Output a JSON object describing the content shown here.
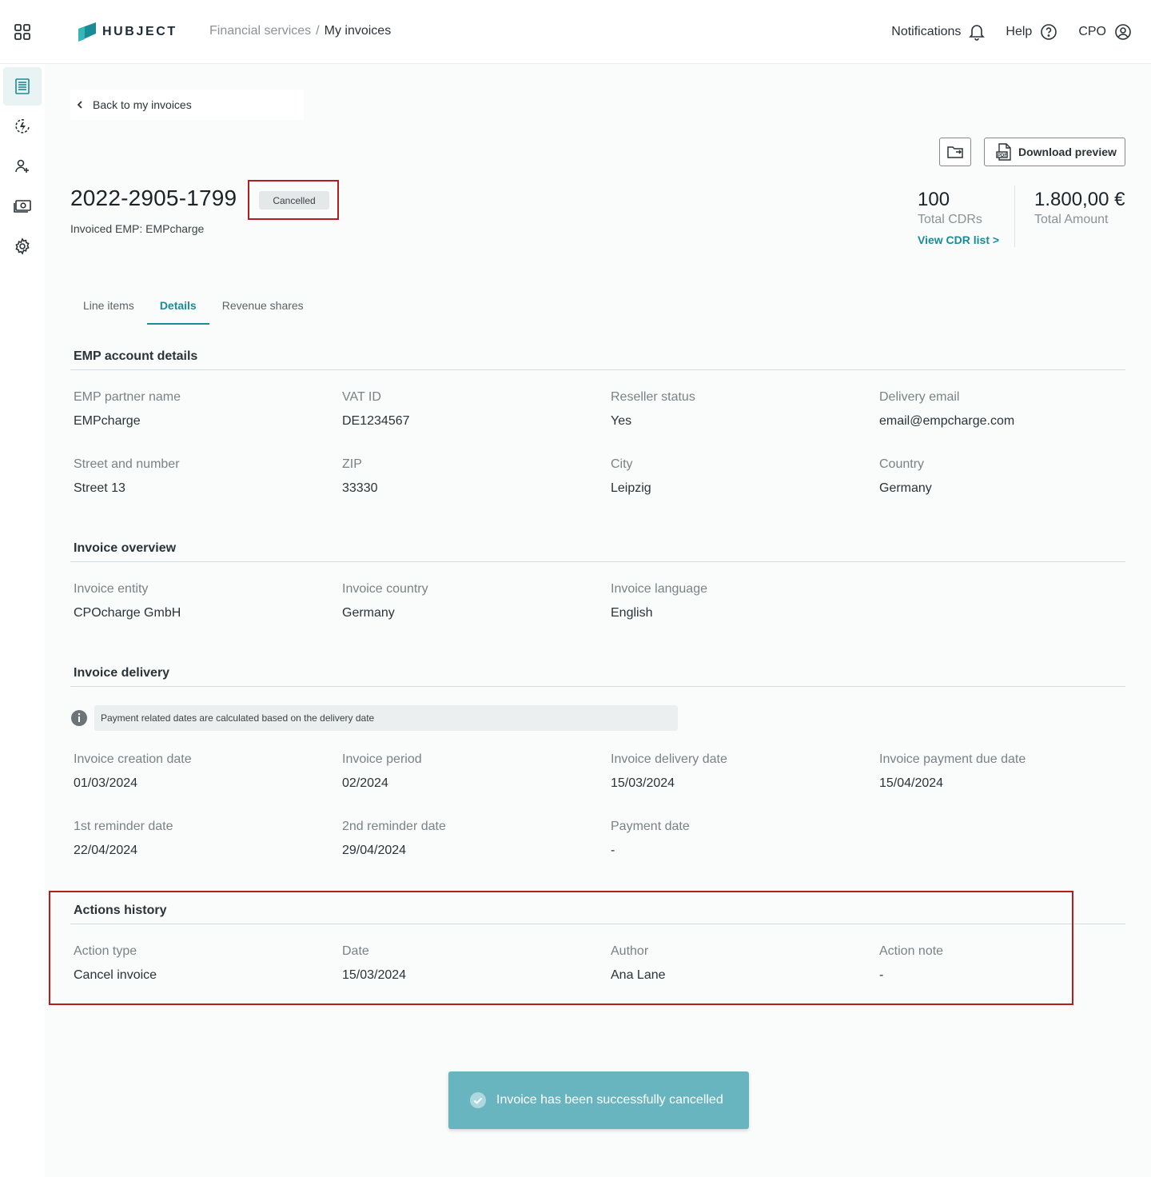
{
  "header": {
    "logo_text": "HUBJECT",
    "breadcrumb": {
      "parent": "Financial services",
      "separator": "/",
      "current": "My invoices"
    },
    "notifications_label": "Notifications",
    "help_label": "Help",
    "user_label": "CPO"
  },
  "back_link": "Back to my invoices",
  "actions": {
    "download_label": "Download preview"
  },
  "invoice": {
    "number": "2022-2905-1799",
    "status": "Cancelled",
    "subtitle": "Invoiced EMP: EMPcharge"
  },
  "stats": {
    "cdrs_value": "100",
    "cdrs_label": "Total CDRs",
    "cdrs_link": "View CDR list >",
    "amount_value": "1.800,00 €",
    "amount_label": "Total Amount"
  },
  "tabs": [
    "Line items",
    "Details",
    "Revenue shares"
  ],
  "emp_account": {
    "title": "EMP account details",
    "fields": [
      {
        "label": "EMP partner name",
        "value": "EMPcharge"
      },
      {
        "label": "VAT ID",
        "value": "DE1234567"
      },
      {
        "label": "Reseller status",
        "value": "Yes"
      },
      {
        "label": "Delivery email",
        "value": "email@empcharge.com"
      },
      {
        "label": "Street and number",
        "value": "Street 13"
      },
      {
        "label": "ZIP",
        "value": "33330"
      },
      {
        "label": "City",
        "value": "Leipzig"
      },
      {
        "label": "Country",
        "value": "Germany"
      }
    ]
  },
  "invoice_overview": {
    "title": "Invoice overview",
    "fields": [
      {
        "label": "Invoice entity",
        "value": "CPOcharge GmbH"
      },
      {
        "label": "Invoice country",
        "value": "Germany"
      },
      {
        "label": "Invoice language",
        "value": "English"
      }
    ]
  },
  "invoice_delivery": {
    "title": "Invoice delivery",
    "info": "Payment related dates are calculated based on the delivery date",
    "fields": [
      {
        "label": "Invoice creation date",
        "value": "01/03/2024"
      },
      {
        "label": "Invoice period",
        "value": "02/2024"
      },
      {
        "label": "Invoice delivery date",
        "value": "15/03/2024"
      },
      {
        "label": "Invoice payment due date",
        "value": "15/04/2024"
      },
      {
        "label": "1st reminder date",
        "value": "22/04/2024"
      },
      {
        "label": "2nd reminder date",
        "value": "29/04/2024"
      },
      {
        "label": "Payment date",
        "value": "-"
      }
    ]
  },
  "actions_history": {
    "title": "Actions history",
    "fields": [
      {
        "label": "Action type",
        "value": "Cancel invoice"
      },
      {
        "label": "Date",
        "value": "15/03/2024"
      },
      {
        "label": "Author",
        "value": "Ana Lane"
      },
      {
        "label": "Action note",
        "value": "-"
      }
    ]
  },
  "toast": {
    "message": "Invoice has been successfully cancelled"
  },
  "colors": {
    "accent": "#1a8c95",
    "highlight": "#b71c1c",
    "toast": "#68b5c0"
  }
}
